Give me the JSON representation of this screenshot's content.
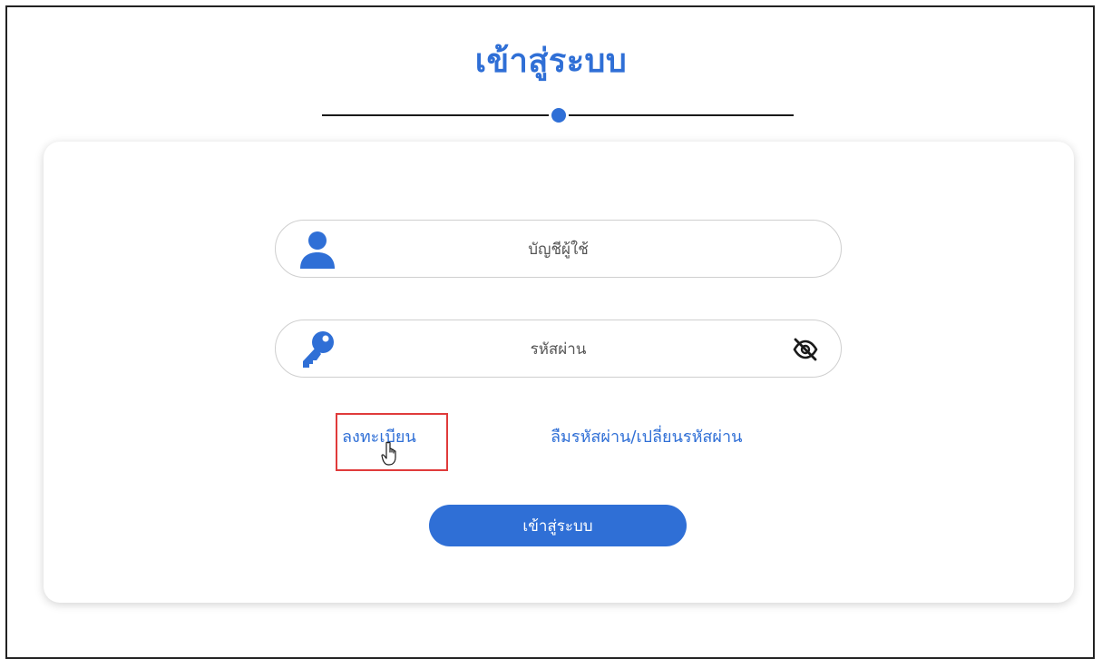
{
  "page": {
    "title": "เข้าสู่ระบบ"
  },
  "form": {
    "username": {
      "placeholder": "บัญชีผู้ใช้",
      "icon": "user-icon"
    },
    "password": {
      "placeholder": "รหัสผ่าน",
      "icon": "key-icon",
      "toggle_icon": "eye-slash-icon"
    },
    "links": {
      "register": "ลงทะเบียน",
      "forgot": "ลืมรหัสผ่าน/เปลี่ยนรหัสผ่าน"
    },
    "submit_label": "เข้าสู่ระบบ"
  },
  "colors": {
    "accent": "#2f6fd6",
    "highlight": "#e03b3b"
  }
}
